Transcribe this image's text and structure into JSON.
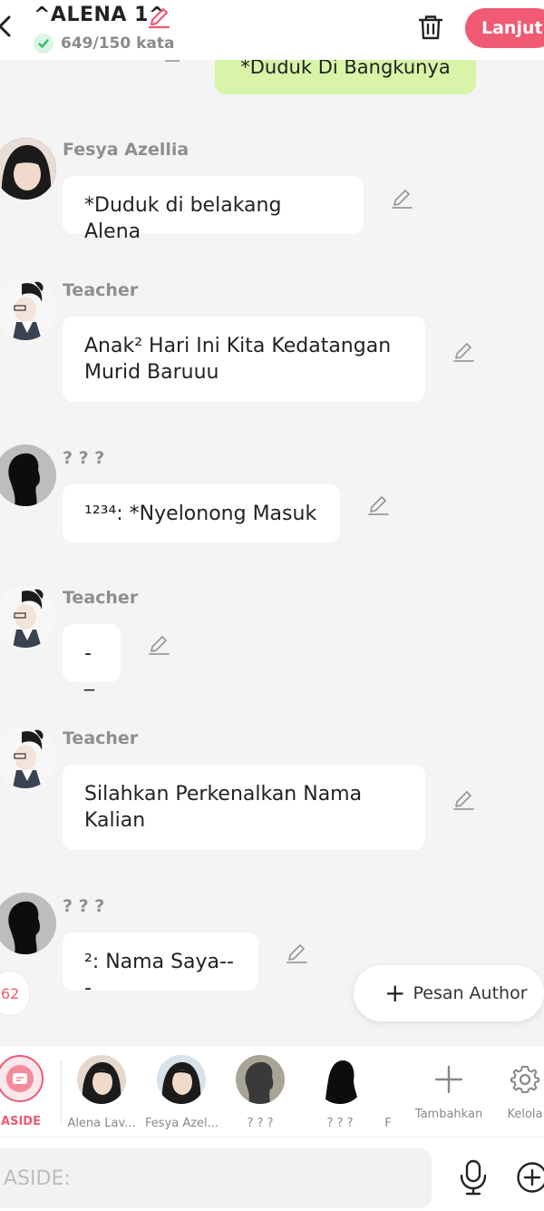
{
  "header": {
    "title": "^ALENA 1^",
    "word_count": "649/150 kata",
    "next_label": "Lanjut"
  },
  "top_message": {
    "text": "*Duduk Di Bangkunya"
  },
  "messages": [
    {
      "name": "Fesya Azellia",
      "text": "*Duduk di belakang Alena"
    },
    {
      "name": "Teacher",
      "text": "Anak² Hari Ini Kita Kedatangan Murid Baruuu"
    },
    {
      "name": "? ? ?",
      "text": "¹²³⁴: *Nyelonong Masuk"
    },
    {
      "name": "Teacher",
      "text": "-_"
    },
    {
      "name": "Teacher",
      "text": "Silahkan Perkenalkan Nama Kalian"
    },
    {
      "name": "? ? ?",
      "text": "²: Nama Saya---"
    }
  ],
  "floating": {
    "badge": "62",
    "author_label": "Pesan Author"
  },
  "characters": [
    {
      "label": "ASIDE"
    },
    {
      "label": "Alena Lav..."
    },
    {
      "label": "Fesya Azel..."
    },
    {
      "label": "? ? ?"
    },
    {
      "label": "? ? ?"
    },
    {
      "label": "F"
    },
    {
      "label": "Tambahkan"
    },
    {
      "label": "Kelola"
    }
  ],
  "input": {
    "placeholder": "ASIDE:"
  },
  "colors": {
    "accent": "#f05a73",
    "my_bubble": "#d8f4a8",
    "background": "#f4f4f4"
  }
}
